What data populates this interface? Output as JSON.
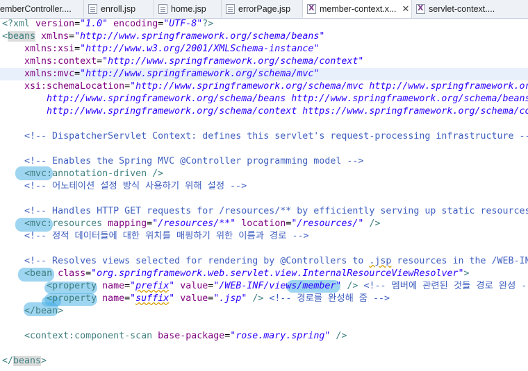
{
  "tabs": [
    {
      "label": "emberController....",
      "icon": "java-file-icon",
      "active": false
    },
    {
      "label": "enroll.jsp",
      "icon": "jsp-file-icon",
      "active": false
    },
    {
      "label": "home.jsp",
      "icon": "jsp-file-icon",
      "active": false
    },
    {
      "label": "errorPage.jsp",
      "icon": "jsp-file-icon",
      "active": false
    },
    {
      "label": "member-context.x...",
      "icon": "xml-file-icon",
      "active": true,
      "close": "✕"
    },
    {
      "label": "servlet-context....",
      "icon": "xml-file-icon",
      "active": false
    }
  ],
  "code": {
    "l1": {
      "a": "<?xml ",
      "b": "version",
      "c": "=",
      "d": "\"1.0\"",
      "e": " ",
      "f": "encoding",
      "g": "=",
      "h": "\"UTF-8\"",
      "i": "?>"
    },
    "l2": {
      "a": "<",
      "b": "beans",
      "c": " xmlns",
      "d": "=",
      "e": "\"http://www.springframework.org/schema/beans\""
    },
    "l3": {
      "a": "xmlns:xsi",
      "b": "=",
      "c": "\"http://www.w3.org/2001/XMLSchema-instance\""
    },
    "l4": {
      "a": "xmlns:context",
      "b": "=",
      "c": "\"http://www.springframework.org/schema/context\""
    },
    "l5": {
      "a": "xmlns:mvc",
      "b": "=",
      "c": "\"http://www.springframework.org/schema/mvc\""
    },
    "l6": {
      "a": "xsi:schemaLocation",
      "b": "=",
      "c": "\"http://www.springframework.org/schema/mvc http://www.springframework.or"
    },
    "l7": {
      "a": "http://www.springframework.org/schema/beans http://www.springframework.org/schema/beans"
    },
    "l8": {
      "a": "http://www.springframework.org/schema/context https://www.springframework.org/schema/co"
    },
    "l9": {
      "a": "<!-- DispatcherServlet Context: defines this servlet's request-processing infrastructure --"
    },
    "l10": {
      "a": "<!-- Enables the Spring MVC @Controller programming model -->"
    },
    "l11": {
      "a": "<",
      "b": "mvc:annotation-driven",
      "c": " />"
    },
    "l12": {
      "a": "<!-- 어노테이션 설정 방식 사용하기 위해 설정 -->"
    },
    "l13": {
      "a": "<!-- Handles HTTP GET requests for /resources/** by efficiently serving up static resources"
    },
    "l14": {
      "a": "<",
      "b": "mvc:resources",
      "c": " mapping",
      "d": "=",
      "e": "\"/resources/**\"",
      "f": " location",
      "g": "=",
      "h": "\"/resources/\"",
      "i": " />"
    },
    "l15": {
      "a": "<!-- 정적 데이터들에 대한 위치를 매핑하기 위한 이름과 경로 -->"
    },
    "l16": {
      "a": "<!-- Resolves views selected for rendering by @Controllers to ",
      "b": ".jsp",
      "c": " resources in the /WEB-IN"
    },
    "l17": {
      "a": "<",
      "b": "bean",
      "c": " class",
      "d": "=",
      "e": "\"org.springframework.web.servlet.view.InternalResourceViewResolver\"",
      "f": ">"
    },
    "l18": {
      "a": "<",
      "b": "property",
      "c": " name",
      "d": "=",
      "e": "\"",
      "f": "prefix",
      "g": "\"",
      "h": " value",
      "i": "=",
      "j": "\"/WEB-INF/views/member\"",
      "k": " /> ",
      "l": "<!-- 멤버에 관련된 것들 경로 완성 -->"
    },
    "l19": {
      "a": "<",
      "b": "property",
      "c": " name",
      "d": "=",
      "e": "\"",
      "f": "suffix",
      "g": "\"",
      "h": " value",
      "i": "=",
      "j": "\".jsp\"",
      "k": " /> ",
      "l": "<!-- 경로를 완성해 줌 -->"
    },
    "l20": {
      "a": "</",
      "b": "bean",
      "c": ">"
    },
    "l21": {
      "a": "<",
      "b": "context:component-scan",
      "c": " base-package",
      "d": "=",
      "e": "\"rose.mary.spring\"",
      "f": " />"
    },
    "l22": {
      "a": "</",
      "b": "beans",
      "c": ">"
    }
  },
  "colors": {
    "tag": "#3f7f7f",
    "attribute": "#7f007f",
    "string": "#2a00ff",
    "comment": "#3f5fbf",
    "highlighter": "#4fb3e6",
    "current_line": "#e8f0fb"
  }
}
